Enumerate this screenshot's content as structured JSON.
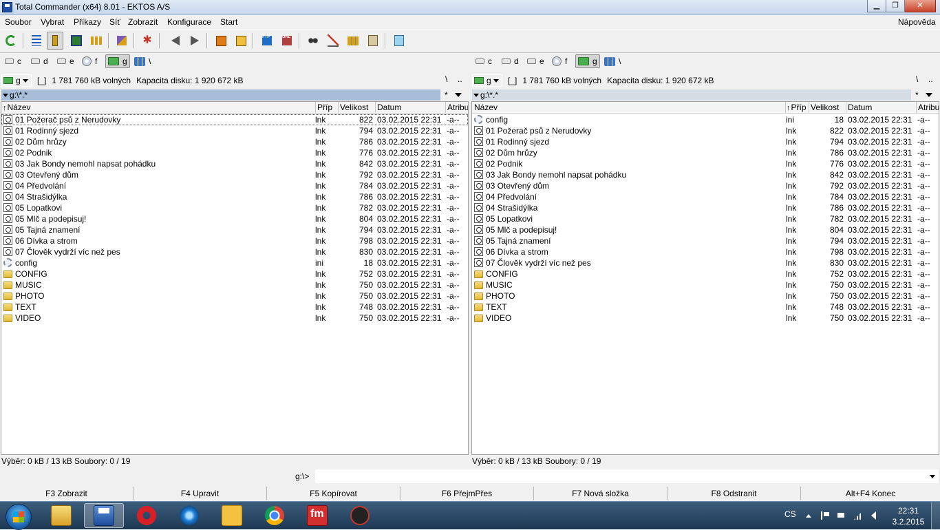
{
  "window": {
    "title": "Total Commander (x64) 8.01 - EKTOS A/S",
    "controls": [
      "minimize",
      "maximize",
      "close"
    ]
  },
  "menu": {
    "items": [
      "Soubor",
      "Vybrat",
      "Příkazy",
      "Síť",
      "Zobrazit",
      "Konfigurace",
      "Start"
    ],
    "help": "Nápověda"
  },
  "toolbar": {
    "buttons": [
      {
        "icon": "refresh-icon"
      },
      {
        "icon": "brief-view-icon"
      },
      {
        "icon": "full-view-icon",
        "pressed": true
      },
      {
        "icon": "thumbnail-view-icon"
      },
      {
        "icon": "tree-view-icon"
      },
      {
        "icon": "compare-dirs-icon"
      },
      {
        "icon": "select-icon"
      },
      {
        "icon": "back-arrow-icon"
      },
      {
        "icon": "forward-arrow-icon"
      },
      {
        "icon": "pack-icon"
      },
      {
        "icon": "unpack-icon"
      },
      {
        "icon": "ftp-connect-icon"
      },
      {
        "icon": "url-connect-icon"
      },
      {
        "icon": "search-icon"
      },
      {
        "icon": "multi-rename-icon"
      },
      {
        "icon": "sync-dirs-icon"
      },
      {
        "icon": "copy-names-icon"
      },
      {
        "icon": "notepad-icon"
      }
    ]
  },
  "drives": {
    "left": [
      {
        "letter": "c",
        "type": "hdd"
      },
      {
        "letter": "d",
        "type": "hdd"
      },
      {
        "letter": "e",
        "type": "hdd"
      },
      {
        "letter": "f",
        "type": "cd"
      },
      {
        "letter": "g",
        "type": "usb",
        "active": true
      },
      {
        "letter": "\\",
        "type": "network"
      }
    ],
    "right": [
      {
        "letter": "c",
        "type": "hdd"
      },
      {
        "letter": "d",
        "type": "hdd"
      },
      {
        "letter": "e",
        "type": "hdd"
      },
      {
        "letter": "f",
        "type": "cd"
      },
      {
        "letter": "g",
        "type": "usb",
        "active": true
      },
      {
        "letter": "\\",
        "type": "network"
      }
    ]
  },
  "left_panel": {
    "drive": "g",
    "label": "[_]",
    "free": "1 781 760 kB volných",
    "capacity": "Kapacita disku: 1 920 672 kB",
    "root_btn": "\\",
    "up_btn": "..",
    "path": "g:\\*.*",
    "history": "*",
    "columns": {
      "name": "Název",
      "ext": "Příp",
      "size": "Velikost",
      "date": "Datum",
      "attr": "Atribu"
    },
    "sorted_by": "name",
    "files": [
      {
        "type": "lnk",
        "name": "01 Požerač psů z Nerudovky",
        "ext": "lnk",
        "size": "822",
        "date": "03.02.2015 22:31",
        "attr": "-a--"
      },
      {
        "type": "lnk",
        "name": "01 Rodinný sjezd",
        "ext": "lnk",
        "size": "794",
        "date": "03.02.2015 22:31",
        "attr": "-a--"
      },
      {
        "type": "lnk",
        "name": "02 Dům hrůzy",
        "ext": "lnk",
        "size": "786",
        "date": "03.02.2015 22:31",
        "attr": "-a--"
      },
      {
        "type": "lnk",
        "name": "02 Podnik",
        "ext": "lnk",
        "size": "776",
        "date": "03.02.2015 22:31",
        "attr": "-a--"
      },
      {
        "type": "lnk",
        "name": "03 Jak Bondy nemohl napsat pohádku",
        "ext": "lnk",
        "size": "842",
        "date": "03.02.2015 22:31",
        "attr": "-a--"
      },
      {
        "type": "lnk",
        "name": "03 Otevřený dům",
        "ext": "lnk",
        "size": "792",
        "date": "03.02.2015 22:31",
        "attr": "-a--"
      },
      {
        "type": "lnk",
        "name": "04 Předvolání",
        "ext": "lnk",
        "size": "784",
        "date": "03.02.2015 22:31",
        "attr": "-a--"
      },
      {
        "type": "lnk",
        "name": "04 Strašidýlka",
        "ext": "lnk",
        "size": "786",
        "date": "03.02.2015 22:31",
        "attr": "-a--"
      },
      {
        "type": "lnk",
        "name": "05 Lopatkovi",
        "ext": "lnk",
        "size": "782",
        "date": "03.02.2015 22:31",
        "attr": "-a--"
      },
      {
        "type": "lnk",
        "name": "05 Mlč a podepisuj!",
        "ext": "lnk",
        "size": "804",
        "date": "03.02.2015 22:31",
        "attr": "-a--"
      },
      {
        "type": "lnk",
        "name": "05 Tajná znamení",
        "ext": "lnk",
        "size": "794",
        "date": "03.02.2015 22:31",
        "attr": "-a--"
      },
      {
        "type": "lnk",
        "name": "06 Dívka a strom",
        "ext": "lnk",
        "size": "798",
        "date": "03.02.2015 22:31",
        "attr": "-a--"
      },
      {
        "type": "lnk",
        "name": "07 Člověk vydrží víc než pes",
        "ext": "lnk",
        "size": "830",
        "date": "03.02.2015 22:31",
        "attr": "-a--"
      },
      {
        "type": "ini",
        "name": "config",
        "ext": "ini",
        "size": "18",
        "date": "03.02.2015 22:31",
        "attr": "-a--"
      },
      {
        "type": "folder",
        "name": "CONFIG",
        "ext": "lnk",
        "size": "752",
        "date": "03.02.2015 22:31",
        "attr": "-a--"
      },
      {
        "type": "folder",
        "name": "MUSIC",
        "ext": "lnk",
        "size": "750",
        "date": "03.02.2015 22:31",
        "attr": "-a--"
      },
      {
        "type": "folder",
        "name": "PHOTO",
        "ext": "lnk",
        "size": "750",
        "date": "03.02.2015 22:31",
        "attr": "-a--"
      },
      {
        "type": "folder",
        "name": "TEXT",
        "ext": "lnk",
        "size": "748",
        "date": "03.02.2015 22:31",
        "attr": "-a--"
      },
      {
        "type": "folder",
        "name": "VIDEO",
        "ext": "lnk",
        "size": "750",
        "date": "03.02.2015 22:31",
        "attr": "-a--"
      }
    ],
    "status": "Výběr: 0 kB / 13 kB  Soubory: 0 / 19"
  },
  "right_panel": {
    "drive": "g",
    "label": "[_]",
    "free": "1 781 760 kB volných",
    "capacity": "Kapacita disku: 1 920 672 kB",
    "root_btn": "\\",
    "up_btn": "..",
    "path": "g:\\*.*",
    "history": "*",
    "columns": {
      "name": "Název",
      "ext": "Příp",
      "size": "Velikost",
      "date": "Datum",
      "attr": "Atribu"
    },
    "sorted_by": "ext",
    "files": [
      {
        "type": "ini",
        "name": "config",
        "ext": "ini",
        "size": "18",
        "date": "03.02.2015 22:31",
        "attr": "-a--"
      },
      {
        "type": "lnk",
        "name": "01 Požerač psů z Nerudovky",
        "ext": "lnk",
        "size": "822",
        "date": "03.02.2015 22:31",
        "attr": "-a--"
      },
      {
        "type": "lnk",
        "name": "01 Rodinný sjezd",
        "ext": "lnk",
        "size": "794",
        "date": "03.02.2015 22:31",
        "attr": "-a--"
      },
      {
        "type": "lnk",
        "name": "02 Dům hrůzy",
        "ext": "lnk",
        "size": "786",
        "date": "03.02.2015 22:31",
        "attr": "-a--"
      },
      {
        "type": "lnk",
        "name": "02 Podnik",
        "ext": "lnk",
        "size": "776",
        "date": "03.02.2015 22:31",
        "attr": "-a--"
      },
      {
        "type": "lnk",
        "name": "03 Jak Bondy nemohl napsat pohádku",
        "ext": "lnk",
        "size": "842",
        "date": "03.02.2015 22:31",
        "attr": "-a--"
      },
      {
        "type": "lnk",
        "name": "03 Otevřený dům",
        "ext": "lnk",
        "size": "792",
        "date": "03.02.2015 22:31",
        "attr": "-a--"
      },
      {
        "type": "lnk",
        "name": "04 Předvolání",
        "ext": "lnk",
        "size": "784",
        "date": "03.02.2015 22:31",
        "attr": "-a--"
      },
      {
        "type": "lnk",
        "name": "04 Strašidýlka",
        "ext": "lnk",
        "size": "786",
        "date": "03.02.2015 22:31",
        "attr": "-a--"
      },
      {
        "type": "lnk",
        "name": "05 Lopatkovi",
        "ext": "lnk",
        "size": "782",
        "date": "03.02.2015 22:31",
        "attr": "-a--"
      },
      {
        "type": "lnk",
        "name": "05 Mlč a podepisuj!",
        "ext": "lnk",
        "size": "804",
        "date": "03.02.2015 22:31",
        "attr": "-a--"
      },
      {
        "type": "lnk",
        "name": "05 Tajná znamení",
        "ext": "lnk",
        "size": "794",
        "date": "03.02.2015 22:31",
        "attr": "-a--"
      },
      {
        "type": "lnk",
        "name": "06 Dívka a strom",
        "ext": "lnk",
        "size": "798",
        "date": "03.02.2015 22:31",
        "attr": "-a--"
      },
      {
        "type": "lnk",
        "name": "07 Člověk vydrží víc než pes",
        "ext": "lnk",
        "size": "830",
        "date": "03.02.2015 22:31",
        "attr": "-a--"
      },
      {
        "type": "folder",
        "name": "CONFIG",
        "ext": "lnk",
        "size": "752",
        "date": "03.02.2015 22:31",
        "attr": "-a--"
      },
      {
        "type": "folder",
        "name": "MUSIC",
        "ext": "lnk",
        "size": "750",
        "date": "03.02.2015 22:31",
        "attr": "-a--"
      },
      {
        "type": "folder",
        "name": "PHOTO",
        "ext": "lnk",
        "size": "750",
        "date": "03.02.2015 22:31",
        "attr": "-a--"
      },
      {
        "type": "folder",
        "name": "TEXT",
        "ext": "lnk",
        "size": "748",
        "date": "03.02.2015 22:31",
        "attr": "-a--"
      },
      {
        "type": "folder",
        "name": "VIDEO",
        "ext": "lnk",
        "size": "750",
        "date": "03.02.2015 22:31",
        "attr": "-a--"
      }
    ],
    "status": "Výběr: 0 kB / 13 kB  Soubory: 0 / 19"
  },
  "command_line": {
    "prompt": "g:\\>",
    "value": ""
  },
  "fkeys": [
    "F3 Zobrazit",
    "F4 Upravit",
    "F5 Kopírovat",
    "F6 PřejmPřes",
    "F7 Nová složka",
    "F8 Odstranit",
    "Alt+F4 Konec"
  ],
  "taskbar": {
    "apps": [
      "explorer-icon",
      "total-commander-icon",
      "opera-icon",
      "internet-explorer-icon",
      "photo-viewer-icon",
      "chrome-icon",
      "fm-icon",
      "tool-icon"
    ],
    "language": "CS",
    "time": "22:31",
    "date": "3.2.2015"
  }
}
